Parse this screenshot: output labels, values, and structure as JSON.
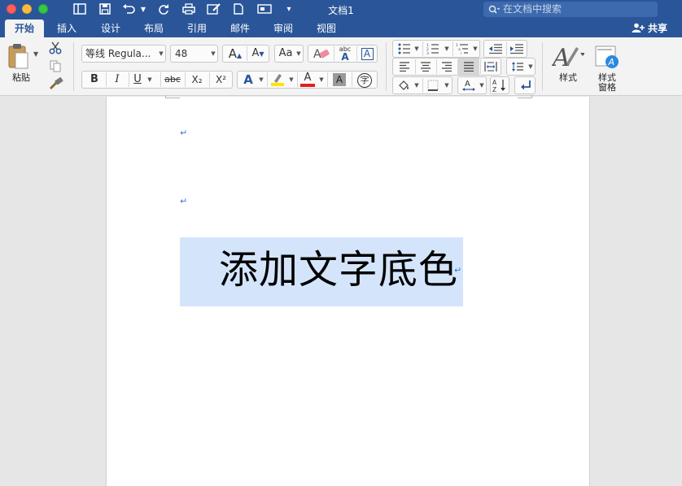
{
  "window": {
    "title": "文档1",
    "search_placeholder": "在文档中搜索"
  },
  "tabs": [
    {
      "label": "开始",
      "active": true
    },
    {
      "label": "插入"
    },
    {
      "label": "设计"
    },
    {
      "label": "布局"
    },
    {
      "label": "引用"
    },
    {
      "label": "邮件"
    },
    {
      "label": "审阅"
    },
    {
      "label": "视图"
    }
  ],
  "share_label": "共享",
  "clipboard": {
    "paste_label": "粘贴"
  },
  "font": {
    "name": "等线 Regula...",
    "size": "48",
    "bold": "B",
    "italic": "I",
    "underline": "U",
    "strikethrough": "abc",
    "subscript": "X₂",
    "superscript": "X²",
    "phonetic": "字",
    "grow": "A",
    "shrink": "A",
    "case": "Aa",
    "text_effect": "A",
    "highlight": "A",
    "font_color": "A",
    "char_shading": "A",
    "abc_label": "abc",
    "border_char": "A"
  },
  "styles": {
    "styles_label": "样式",
    "pane_label_1": "样式",
    "pane_label_2": "窗格"
  },
  "document": {
    "text": "添加文字底色",
    "para_mark": "↵"
  },
  "colors": {
    "titlebar": "#2a5699",
    "highlight": "#ffe600",
    "font_color_bar": "#e02020",
    "text_shade": "#d4e5fb",
    "para_mark": "#3a7bd5"
  }
}
